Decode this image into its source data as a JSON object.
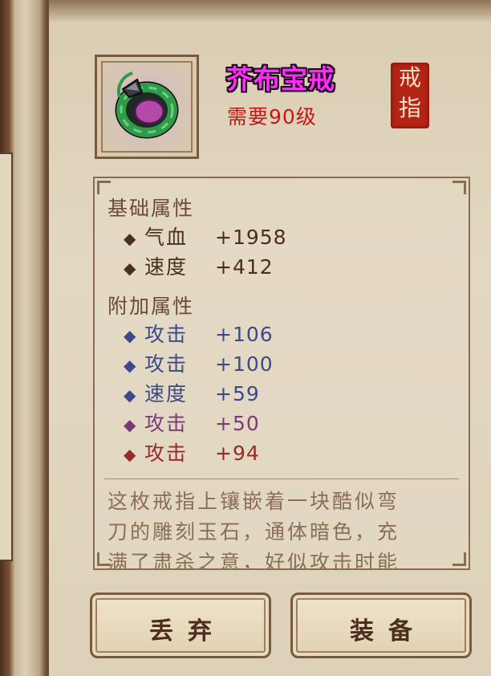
{
  "item": {
    "name": "芥布宝戒",
    "level_requirement": "需要90级",
    "seal": [
      "戒",
      "指"
    ],
    "icon": "jade-ring-icon"
  },
  "base_attributes": {
    "title": "基础属性",
    "rows": [
      {
        "label": "气血",
        "value": "+1958",
        "color": "#4a2f1e",
        "bullet_color": "#4a2f1e"
      },
      {
        "label": "速度",
        "value": "+412",
        "color": "#4a2f1e",
        "bullet_color": "#4a2f1e"
      }
    ]
  },
  "extra_attributes": {
    "title": "附加属性",
    "rows": [
      {
        "label": "攻击",
        "value": "+106",
        "color": "#3a4a8a",
        "bullet_color": "#3a4a8a"
      },
      {
        "label": "攻击",
        "value": "+100",
        "color": "#3a4a8a",
        "bullet_color": "#3a4a8a"
      },
      {
        "label": "速度",
        "value": "+59",
        "color": "#3a4a8a",
        "bullet_color": "#3a4a8a"
      },
      {
        "label": "攻击",
        "value": "+50",
        "color": "#7a3a7a",
        "bullet_color": "#7a3a7a"
      },
      {
        "label": "攻击",
        "value": "+94",
        "color": "#9a2a2a",
        "bullet_color": "#9a2a2a"
      }
    ]
  },
  "description": {
    "line1": "这枚戒指上镶嵌着一块酷似弯",
    "line2": "刀的雕刻玉石，通体暗色，充",
    "line3": "满了肃杀之意，好似攻击时能"
  },
  "buttons": {
    "discard": "丢弃",
    "equip": "装备"
  },
  "colors": {
    "name": "#ff2bff",
    "level": "#c41818",
    "seal": "#b32414"
  }
}
